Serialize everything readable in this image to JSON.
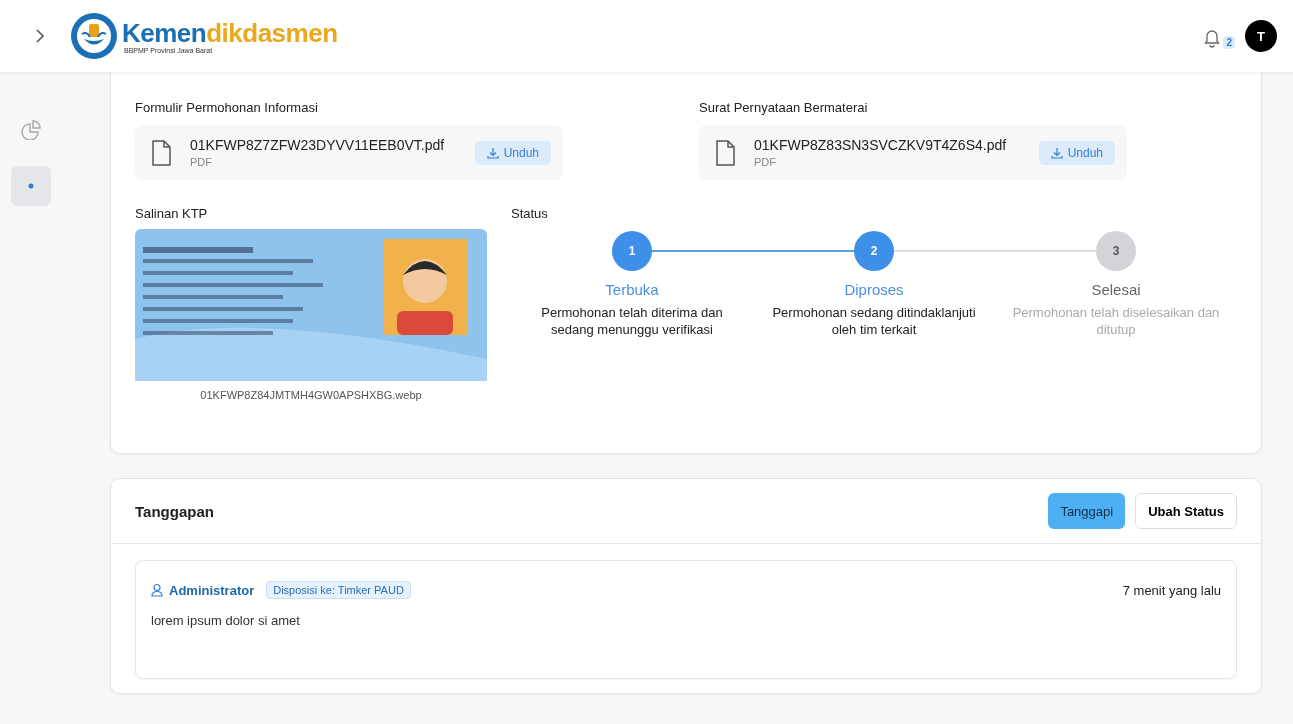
{
  "header": {
    "logo": {
      "part_1": "Kemen",
      "part_2": "dikdasmen",
      "subtitle": "BBPMP Provinsi Jawa Barat"
    },
    "notifications": {
      "count": "2"
    },
    "avatar": {
      "initial": "T"
    }
  },
  "sidebar": {
    "items": [
      {
        "kind": "chart",
        "selected": false
      },
      {
        "kind": "dot",
        "selected": true
      }
    ]
  },
  "documents": [
    {
      "label": "Formulir Permohonan Informasi",
      "file": "01KFWP8Z7ZFW23DYVV11EEB0VT.pdf",
      "type": "PDF",
      "button": "Unduh"
    },
    {
      "label": "Surat Pernyataan Bermaterai",
      "file": "01KFWP8Z83SN3SVCZKV9T4Z6S4.pdf",
      "type": "PDF",
      "button": "Unduh"
    }
  ],
  "ktp": {
    "label": "Salinan KTP",
    "file": "01KFWP8Z84JMTMH4GW0APSHXBG.webp"
  },
  "status": {
    "label": "Status",
    "steps": [
      {
        "number": "1",
        "title": "Terbuka",
        "description": "Permohonan telah diterima dan sedang menunggu verifikasi",
        "reached": true
      },
      {
        "number": "2",
        "title": "Diproses",
        "description": "Permohonan sedang ditindaklanjuti oleh tim terkait",
        "reached": true
      },
      {
        "number": "3",
        "title": "Selesai",
        "description": "Permohonan telah diselesaikan dan ditutup",
        "reached": false
      }
    ]
  },
  "responses": {
    "title": "Tanggapan",
    "buttons": [
      {
        "label": "Tanggapi",
        "kind": "primary"
      },
      {
        "label": "Ubah Status",
        "kind": "outline"
      }
    ],
    "items": [
      {
        "author": "Administrator",
        "tag": "Disposisi ke: Timker PAUD",
        "time": "7 menit yang lalu",
        "body": "lorem ipsum dolor si amet"
      }
    ]
  }
}
